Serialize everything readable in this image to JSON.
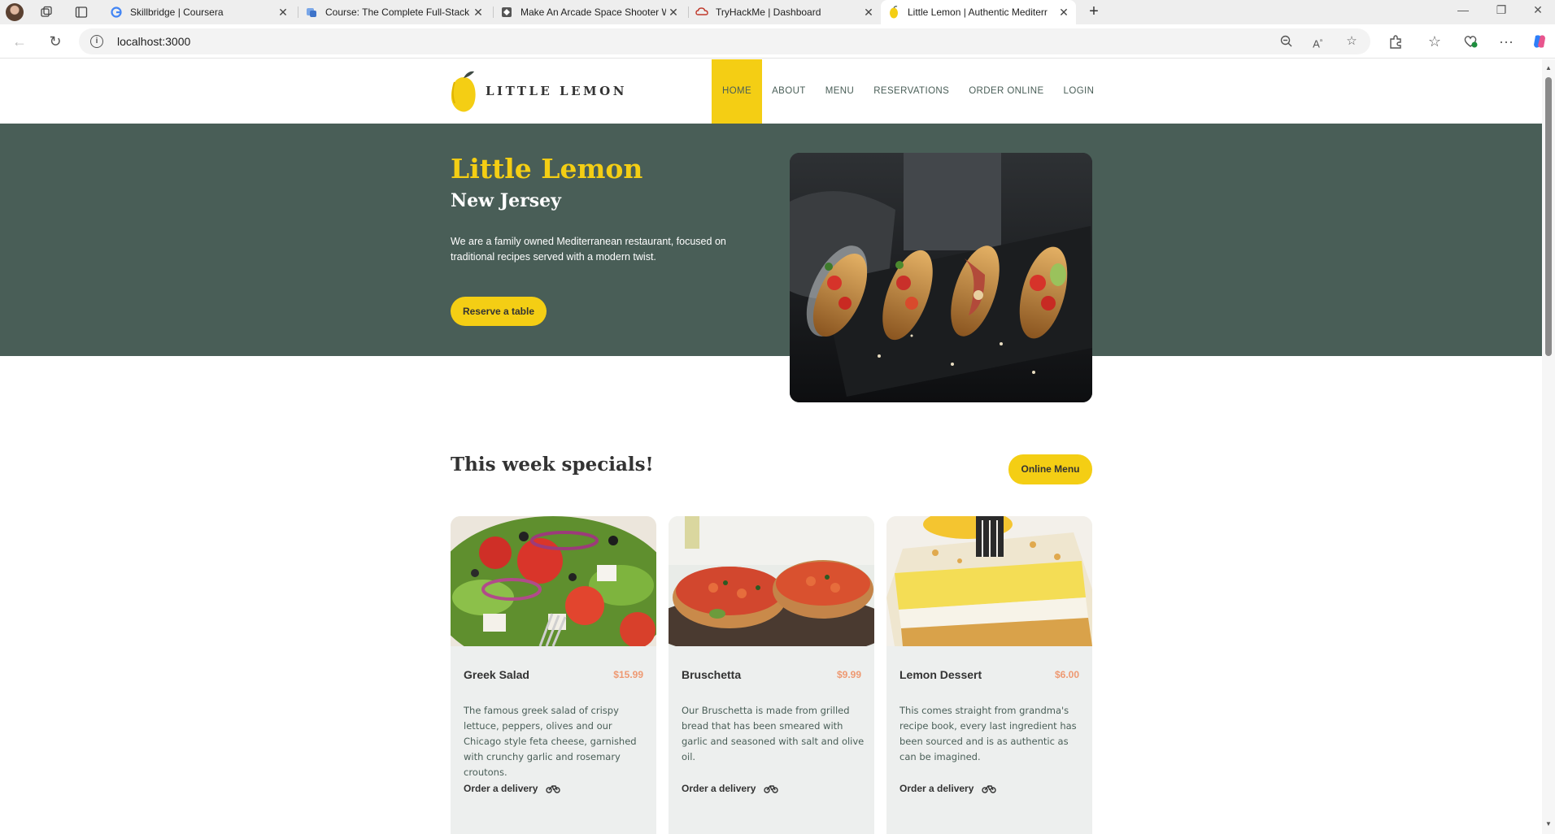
{
  "browser": {
    "tabs": [
      {
        "title": "Skillbridge | Coursera",
        "favicon": "google-icon"
      },
      {
        "title": "Course: The Complete Full-Stack W",
        "favicon": "course-icon"
      },
      {
        "title": "Make An Arcade Space Shooter W",
        "favicon": "unity-icon"
      },
      {
        "title": "TryHackMe | Dashboard",
        "favicon": "tryhackme-icon"
      },
      {
        "title": "Little Lemon | Authentic Mediterr",
        "favicon": "lemon-icon",
        "active": true
      }
    ],
    "new_tab_label": "+",
    "address_url": "localhost:3000",
    "window_controls": {
      "minimize": "—",
      "restore": "❐",
      "close": "✕"
    }
  },
  "site": {
    "brand": "LITTLE LEMON",
    "nav": [
      "HOME",
      "ABOUT",
      "MENU",
      "RESERVATIONS",
      "ORDER ONLINE",
      "LOGIN"
    ],
    "hero": {
      "title": "Little Lemon",
      "subtitle": "New Jersey",
      "description": "We are a family owned Mediterranean restaurant, focused on traditional recipes served with a modern twist.",
      "cta": "Reserve a table"
    },
    "specials": {
      "title": "This week specials!",
      "menu_button": "Online Menu",
      "items": [
        {
          "name": "Greek Salad",
          "price": "$15.99",
          "description": "The famous greek salad of crispy lettuce, peppers, olives and our Chicago style feta cheese, garnished with crunchy garlic and rosemary croutons.",
          "order": "Order a delivery"
        },
        {
          "name": "Bruschetta",
          "price": "$9.99",
          "description": "Our Bruschetta is made from grilled bread that has been smeared with garlic and seasoned with salt and olive oil.",
          "order": "Order a delivery"
        },
        {
          "name": "Lemon Dessert",
          "price": "$6.00",
          "description": "This comes straight from grandma's recipe book, every last ingredient has been sourced and is as authentic as can be imagined.",
          "order": "Order a delivery"
        }
      ]
    }
  },
  "colors": {
    "primary_green": "#495e57",
    "primary_yellow": "#f4ce14",
    "card_bg": "#edefee",
    "price": "#ee9972"
  }
}
